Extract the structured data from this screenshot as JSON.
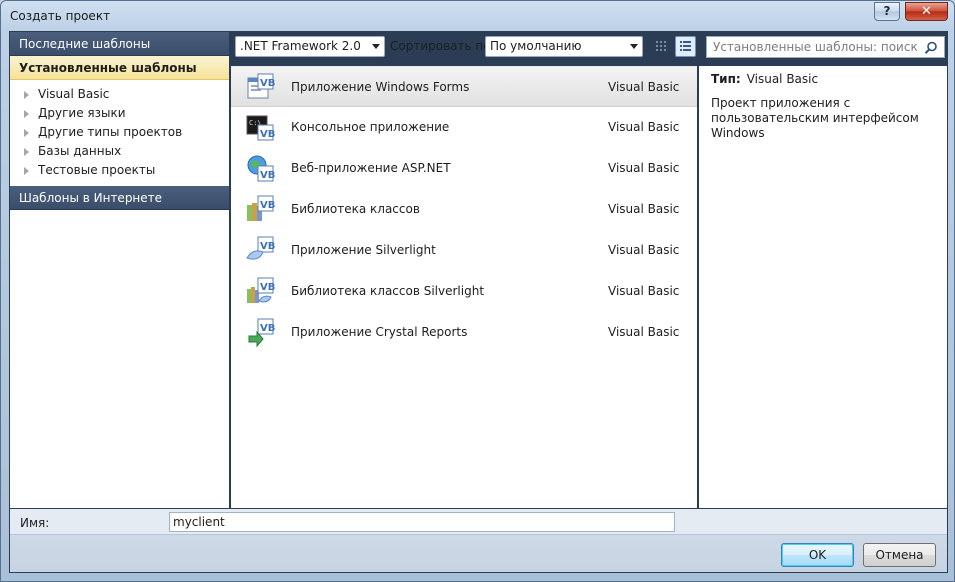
{
  "window": {
    "title": "Создать проект",
    "help_label": "?",
    "close_label": "✕"
  },
  "sidebar": {
    "recent_header": "Последние шаблоны",
    "installed_header": "Установленные шаблоны",
    "items": [
      {
        "label": "Visual Basic"
      },
      {
        "label": "Другие языки"
      },
      {
        "label": "Другие типы проектов"
      },
      {
        "label": "Базы данных"
      },
      {
        "label": "Тестовые проекты"
      }
    ],
    "online_header": "Шаблоны в Интернете"
  },
  "toolbar": {
    "framework_value": ".NET Framework 2.0",
    "sort_label": "Сортировать по:",
    "sort_value": "По умолчанию",
    "search_placeholder": "Установленные шаблоны: поиск"
  },
  "templates": [
    {
      "name": "Приложение Windows Forms",
      "lang": "Visual Basic",
      "icon": "windows-forms-icon"
    },
    {
      "name": "Консольное приложение",
      "lang": "Visual Basic",
      "icon": "console-app-icon"
    },
    {
      "name": "Веб-приложение ASP.NET",
      "lang": "Visual Basic",
      "icon": "web-app-icon"
    },
    {
      "name": "Библиотека классов",
      "lang": "Visual Basic",
      "icon": "class-library-icon"
    },
    {
      "name": "Приложение Silverlight",
      "lang": "Visual Basic",
      "icon": "silverlight-app-icon"
    },
    {
      "name": "Библиотека классов Silverlight",
      "lang": "Visual Basic",
      "icon": "silverlight-library-icon"
    },
    {
      "name": "Приложение Crystal Reports",
      "lang": "Visual Basic",
      "icon": "crystal-reports-icon"
    }
  ],
  "info": {
    "type_label": "Тип:",
    "type_value": "Visual Basic",
    "description": "Проект приложения с пользовательским интерфейсом Windows"
  },
  "bottom": {
    "name_label": "Имя:",
    "name_value": "myclient",
    "ok_label": "OK",
    "cancel_label": "Отмена"
  },
  "colors": {
    "accent_selected": "#f5e39a",
    "header_dark": "#3a4e6a",
    "vb_blue": "#3d6fb6"
  }
}
